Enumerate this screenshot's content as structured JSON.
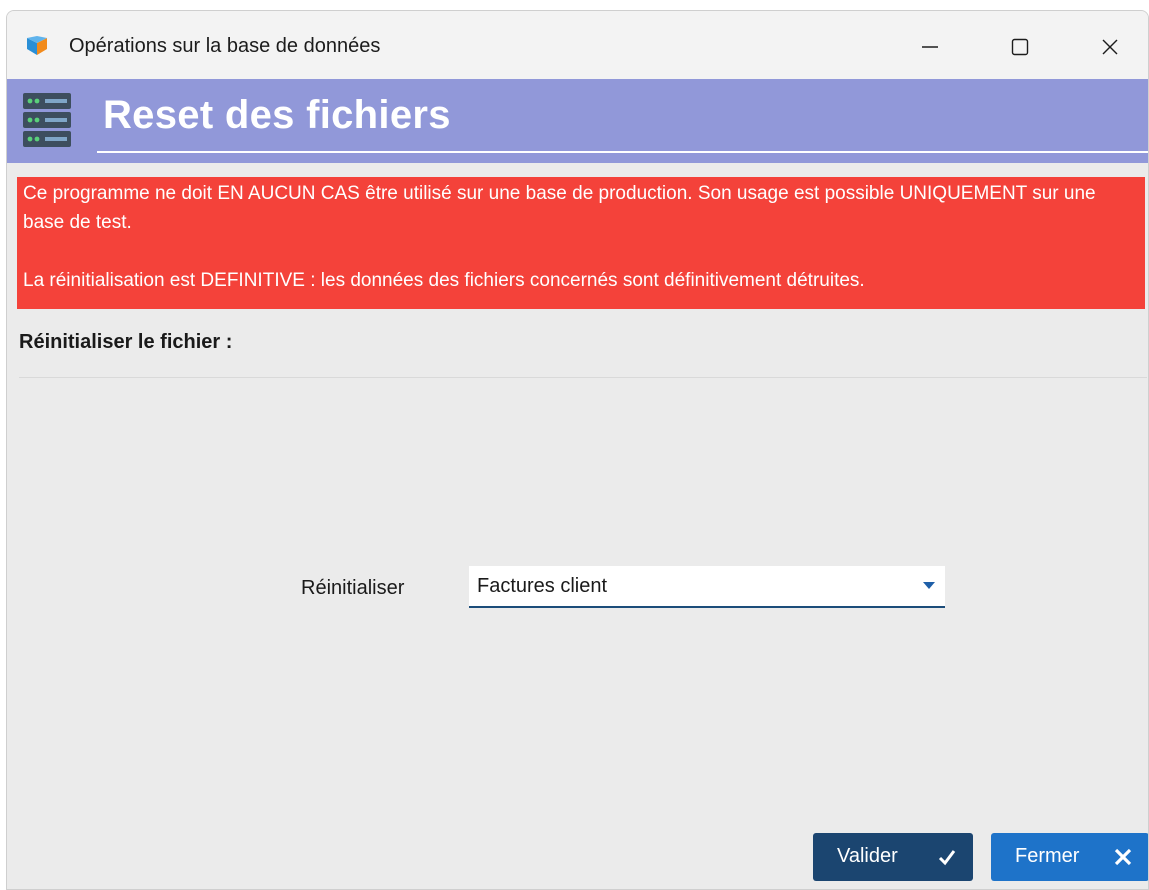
{
  "window": {
    "title": "Opérations sur la base de données"
  },
  "header": {
    "title": "Reset des fichiers",
    "icon": "database-server-icon",
    "color": "#9198d9"
  },
  "warning": {
    "line1": "Ce programme ne doit EN AUCUN CAS être utilisé sur une base de production. Son usage est possible UNIQUEMENT sur une base de test.",
    "line2": "La réinitialisation est DEFINITIVE : les données des fichiers concernés sont définitivement détruites.",
    "color": "#f4423a"
  },
  "section": {
    "label": "Réinitialiser le fichier :"
  },
  "reset_field": {
    "label": "Réinitialiser",
    "value": "Factures client"
  },
  "buttons": {
    "validate_label": "Valider",
    "close_label": "Fermer"
  }
}
